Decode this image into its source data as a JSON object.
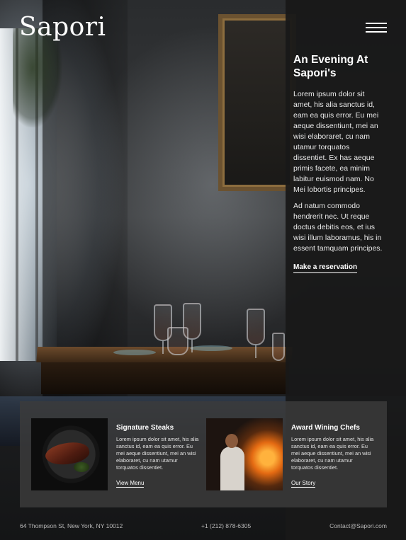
{
  "brand": {
    "name": "Sapori"
  },
  "nav": {
    "menu_icon": "hamburger-menu-icon"
  },
  "intro": {
    "title": "An Evening At Sapori's",
    "paragraphs": [
      "Lorem ipsum dolor sit amet, his alia sanctus id, eam ea quis error. Eu mei aeque dissentiunt, mei an wisi elaboraret, cu nam utamur torquatos dissentiet. Ex has aeque primis facete, ea minim labitur euismod nam. No Mei lobortis principes.",
      "Ad natum commodo hendrerit nec. Ut reque doctus debitis eos, et ius wisi illum laboramus, his in essent tamquam principes."
    ],
    "cta_label": "Make a reservation"
  },
  "features": [
    {
      "title": "Signature Steaks",
      "body": "Lorem ipsum dolor sit amet, his alia sanctus id, eam ea quis error. Eu mei aeque dissentiunt, mei an wisi elaboraret, cu nam utamur torquatos dissentiet.",
      "link": "View Menu",
      "image": "steak-photo"
    },
    {
      "title": "Award Wining Chefs",
      "body": "Lorem ipsum dolor sit amet, his alia sanctus id, eam ea quis error. Eu mei aeque dissentiunt, mei an wisi elaboraret, cu nam utamur torquatos dissentiet.",
      "link": "Our Story",
      "image": "chef-photo"
    }
  ],
  "footer": {
    "address": "64 Thompson St, New York, NY 10012",
    "phone": "+1 (212) 878-6305",
    "email": "Contact@Sapori.com"
  },
  "colors": {
    "panel": "#181818",
    "strip": "#3c3c3c",
    "text": "#ffffff",
    "footer_text": "#b9b9b9"
  }
}
